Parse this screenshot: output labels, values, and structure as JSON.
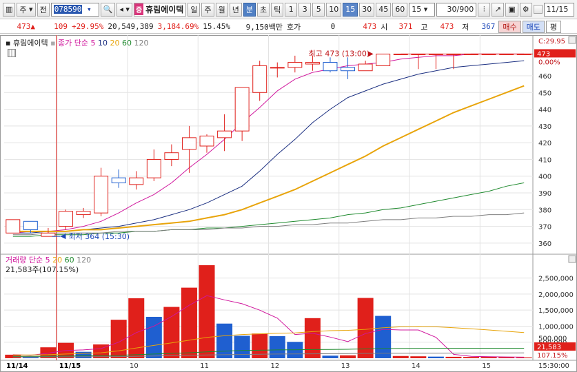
{
  "toolbar": {
    "type_label": "주",
    "prev_label": "전",
    "code": "078590",
    "stock_tag": "증",
    "stock_name": "휴림에이텍",
    "periods": [
      "일",
      "주",
      "월",
      "년"
    ],
    "minute_label": "분",
    "second_label": "초",
    "tick_label": "틱",
    "intervals": [
      "1",
      "3",
      "5",
      "10",
      "15",
      "30",
      "45",
      "60"
    ],
    "selected_interval": "15",
    "interval_select": "15",
    "count_value": "30",
    "count_max": "/900",
    "date_value": "11/15"
  },
  "infobar": {
    "price": "473",
    "change": "109",
    "change_pct": "+29.95%",
    "volume": "20,549,389",
    "volume_pct": "3,184.69%",
    "turnover_pct": "15.45%",
    "amount": "9,150백만",
    "quote_label": "호가",
    "quote_value": "0",
    "price2": "473",
    "open_label": "시",
    "open_value": "371",
    "high_label": "고",
    "high_value": "473",
    "low_label": "저",
    "low_value": "367",
    "buy_label": "매수",
    "sell_label": "매도",
    "eval_label": "평"
  },
  "price_legend": {
    "name": "휴림에이텍",
    "ma_label": "종가 단순",
    "periods": [
      "5",
      "10",
      "20",
      "60",
      "120"
    ]
  },
  "volume_legend": {
    "name": "거래량",
    "ma_label": "단순",
    "periods": [
      "5",
      "20",
      "60",
      "120"
    ],
    "current": "21,583주(107.15%)"
  },
  "annotations": {
    "high": "최고 473 (13:00)",
    "low": "최저 364 (15:30)"
  },
  "axis": {
    "price_badge_top": "C:29.95",
    "price_badge_current": "473",
    "price_badge_zero": "0.00%",
    "vol_badge_current": "21,583",
    "vol_badge_pct": "107.15%",
    "vol_badge_behind": "500,000",
    "time_labels": [
      "11/14",
      "11/15",
      "10",
      "11",
      "12",
      "13",
      "14",
      "15"
    ],
    "time_right": "15:30:00"
  },
  "colors": {
    "up": "#e0201b",
    "down": "#1f5fd0",
    "ma5": "#d0179d",
    "ma10": "#1a2e80",
    "ma20": "#e8a40a",
    "ma60": "#1f8a2e",
    "ma120": "#7d7d7d"
  },
  "chart_data": [
    {
      "type": "candlestick",
      "title": "",
      "ylim": [
        355,
        481
      ],
      "yticks": [
        360,
        370,
        380,
        390,
        400,
        410,
        420,
        430,
        440,
        450,
        460
      ],
      "candles": [
        {
          "o": 366,
          "h": 374,
          "l": 366,
          "c": 374
        },
        {
          "o": 373,
          "h": 373,
          "l": 366,
          "c": 368
        },
        {
          "o": 364,
          "h": 369,
          "l": 364,
          "c": 366
        },
        {
          "o": 370,
          "h": 380,
          "l": 368,
          "c": 379
        },
        {
          "o": 377,
          "h": 381,
          "l": 375,
          "c": 379
        },
        {
          "o": 378,
          "h": 405,
          "l": 376,
          "c": 400
        },
        {
          "o": 399,
          "h": 404,
          "l": 393,
          "c": 396
        },
        {
          "o": 395,
          "h": 403,
          "l": 392,
          "c": 399
        },
        {
          "o": 399,
          "h": 416,
          "l": 397,
          "c": 410
        },
        {
          "o": 410,
          "h": 419,
          "l": 406,
          "c": 414
        },
        {
          "o": 416,
          "h": 430,
          "l": 402,
          "c": 423
        },
        {
          "o": 418,
          "h": 425,
          "l": 414,
          "c": 424
        },
        {
          "o": 423,
          "h": 437,
          "l": 415,
          "c": 427
        },
        {
          "o": 427,
          "h": 453,
          "l": 421,
          "c": 453
        },
        {
          "o": 450,
          "h": 469,
          "l": 445,
          "c": 466
        },
        {
          "o": 465,
          "h": 468,
          "l": 459,
          "c": 465
        },
        {
          "o": 465,
          "h": 472,
          "l": 462,
          "c": 468
        },
        {
          "o": 467,
          "h": 472,
          "l": 463,
          "c": 468
        },
        {
          "o": 468,
          "h": 471,
          "l": 462,
          "c": 463
        },
        {
          "o": 465,
          "h": 471,
          "l": 458,
          "c": 463
        },
        {
          "o": 463,
          "h": 469,
          "l": 463,
          "c": 467
        },
        {
          "o": 466,
          "h": 473,
          "l": 466,
          "c": 473
        },
        {
          "o": 473,
          "h": 473,
          "l": 473,
          "c": 473
        },
        {
          "o": 473,
          "h": 473,
          "l": 464,
          "c": 473
        },
        {
          "o": 473,
          "h": 473,
          "l": 464,
          "c": 473
        },
        {
          "o": 473,
          "h": 473,
          "l": 464,
          "c": 473
        },
        {
          "o": 473,
          "h": 473,
          "l": 473,
          "c": 473
        },
        {
          "o": 473,
          "h": 473,
          "l": 473,
          "c": 473
        },
        {
          "o": 473,
          "h": 473,
          "l": 473,
          "c": 473
        },
        {
          "o": 473,
          "h": 473,
          "l": 473,
          "c": 473
        }
      ],
      "series": [
        {
          "name": "5",
          "values": [
            366,
            367,
            367,
            368,
            370,
            373,
            378,
            384,
            389,
            396,
            405,
            413,
            422,
            432,
            441,
            451,
            458,
            462,
            464,
            466,
            467,
            468,
            470,
            471,
            472,
            472,
            473,
            473,
            473,
            473
          ]
        },
        {
          "name": "10",
          "values": [
            366,
            366,
            367,
            367,
            368,
            369,
            370,
            372,
            374,
            377,
            380,
            384,
            389,
            394,
            403,
            413,
            422,
            432,
            440,
            447,
            451,
            455,
            458,
            461,
            463,
            465,
            466,
            467,
            468,
            469
          ]
        },
        {
          "name": "20",
          "values": [
            367,
            367,
            367,
            367,
            368,
            368,
            369,
            370,
            371,
            372,
            373,
            375,
            377,
            380,
            384,
            388,
            392,
            397,
            402,
            407,
            412,
            418,
            423,
            428,
            433,
            438,
            442,
            446,
            450,
            454
          ]
        },
        {
          "name": "60",
          "values": [
            364,
            364,
            365,
            365,
            365,
            366,
            366,
            367,
            367,
            368,
            368,
            369,
            369,
            370,
            371,
            372,
            373,
            374,
            375,
            377,
            378,
            380,
            381,
            383,
            385,
            387,
            389,
            391,
            394,
            396
          ]
        },
        {
          "name": "120",
          "values": [
            365,
            365,
            366,
            366,
            366,
            366,
            367,
            367,
            367,
            368,
            368,
            368,
            369,
            369,
            370,
            370,
            371,
            371,
            372,
            372,
            373,
            374,
            374,
            375,
            375,
            376,
            376,
            377,
            377,
            378
          ]
        }
      ]
    },
    {
      "type": "bar",
      "title": "",
      "ylim": [
        0,
        2900000
      ],
      "yticks": [
        500000,
        1000000,
        1500000,
        2000000,
        2500000
      ],
      "ytick_labels": [
        "500,000",
        "1,000,000",
        "1,500,000",
        "2,000,000",
        "2,500,000"
      ],
      "values": [
        110000,
        30000,
        340000,
        480000,
        200000,
        430000,
        1200000,
        1870000,
        1290000,
        1600000,
        2200000,
        2900000,
        1080000,
        700000,
        770000,
        690000,
        510000,
        1250000,
        80000,
        90000,
        1880000,
        1320000,
        70000,
        60000,
        50000,
        45000,
        40000,
        40000,
        30000,
        25000
      ],
      "up": [
        true,
        false,
        true,
        true,
        false,
        true,
        true,
        true,
        false,
        true,
        true,
        true,
        false,
        false,
        true,
        false,
        false,
        true,
        false,
        true,
        true,
        false,
        true,
        true,
        false,
        true,
        true,
        true,
        true,
        true
      ],
      "series": [
        {
          "name": "5",
          "values": [
            110000,
            90000,
            160000,
            240000,
            260000,
            300000,
            500000,
            800000,
            1000000,
            1300000,
            1650000,
            1950000,
            1820000,
            1700000,
            1500000,
            1250000,
            740000,
            780000,
            660000,
            520000,
            770000,
            900000,
            880000,
            880000,
            650000,
            120000,
            60000,
            50000,
            40000,
            35000
          ]
        },
        {
          "name": "20",
          "values": [
            100000,
            100000,
            110000,
            130000,
            150000,
            170000,
            230000,
            320000,
            400000,
            480000,
            560000,
            650000,
            700000,
            740000,
            760000,
            780000,
            790000,
            830000,
            860000,
            870000,
            900000,
            950000,
            980000,
            990000,
            980000,
            950000,
            920000,
            880000,
            840000,
            800000
          ]
        },
        {
          "name": "60",
          "values": [
            60000,
            60000,
            65000,
            70000,
            75000,
            80000,
            90000,
            110000,
            130000,
            150000,
            170000,
            200000,
            220000,
            240000,
            250000,
            260000,
            265000,
            270000,
            275000,
            280000,
            290000,
            300000,
            305000,
            310000,
            310000,
            312000,
            312000,
            312000,
            312000,
            312000
          ]
        },
        {
          "name": "120",
          "values": [
            40000,
            40000,
            42000,
            44000,
            46000,
            48000,
            52000,
            60000,
            70000,
            80000,
            90000,
            100000,
            110000,
            118000,
            124000,
            130000,
            134000,
            138000,
            142000,
            146000,
            150000,
            154000,
            156000,
            158000,
            160000,
            161000,
            162000,
            163000,
            164000,
            165000
          ]
        }
      ]
    }
  ]
}
